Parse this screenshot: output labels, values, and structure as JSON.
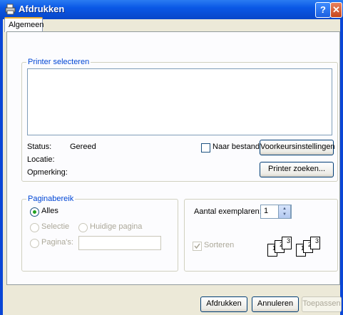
{
  "window": {
    "title": "Afdrukken",
    "help_label": "?",
    "close_label": "✕"
  },
  "tabs": [
    {
      "label": "Algemeen"
    }
  ],
  "printer_group": {
    "legend": "Printer selecteren",
    "status_label": "Status:",
    "status_value": "Gereed",
    "location_label": "Locatie:",
    "comment_label": "Opmerking:",
    "print_to_file_label": "Naar bestand",
    "print_to_file_checked": false,
    "preferences_button": "Voorkeursinstellingen",
    "find_printer_button": "Printer zoeken..."
  },
  "page_range_group": {
    "legend": "Paginabereik",
    "all_label": "Alles",
    "selection_label": "Selectie",
    "current_page_label": "Huidige pagina",
    "pages_label": "Pagina's:",
    "pages_value": "",
    "selected": "all"
  },
  "copies_group": {
    "copies_label": "Aantal exemplaren:",
    "copies_value": "1",
    "collate_label": "Sorteren",
    "collate_checked": true,
    "collate_icon": "collate-pages-icon",
    "page_numbers": [
      "1",
      "2",
      "3"
    ]
  },
  "buttons": {
    "print": "Afdrukken",
    "cancel": "Annuleren",
    "apply": "Toepassen"
  },
  "colors": {
    "title_bar": "#0a58e6",
    "accent_legend": "#0046d5",
    "radio_selected": "#21a121"
  }
}
